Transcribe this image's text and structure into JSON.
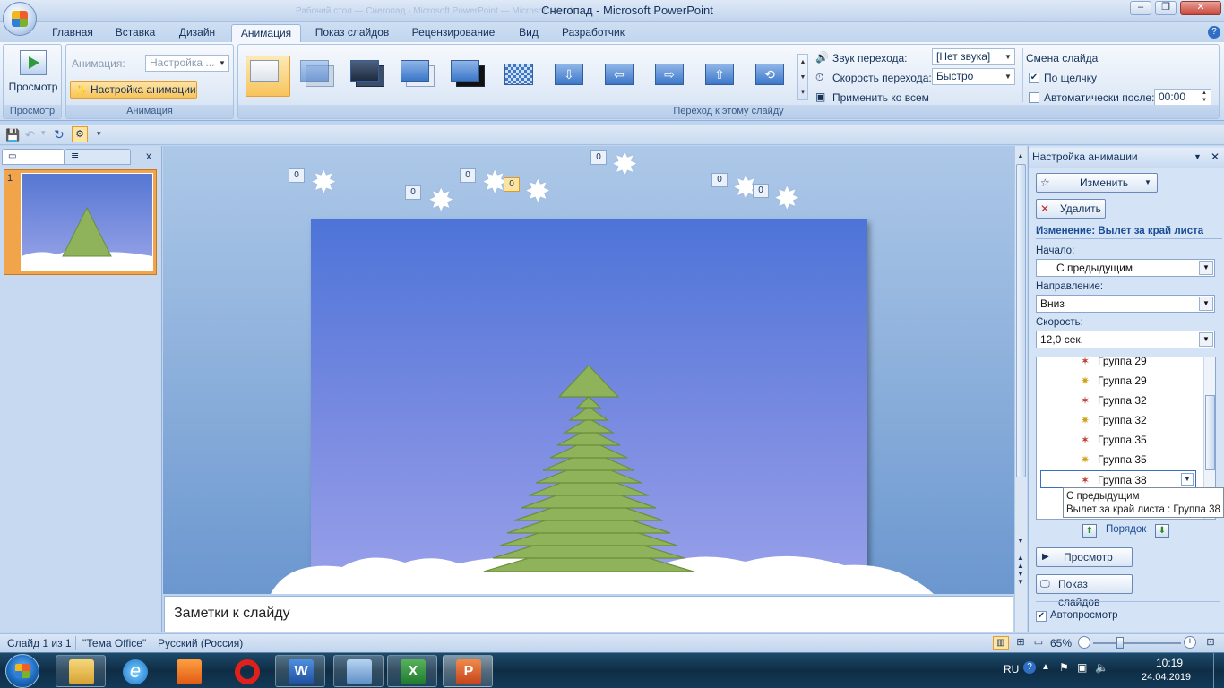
{
  "window": {
    "title": "Снегопад - Microsoft PowerPoint",
    "ghost_title": "Рабочий стол — Снегопад - Microsoft PowerPoint — Microsoft Word"
  },
  "tabs": [
    "Главная",
    "Вставка",
    "Дизайн",
    "Анимация",
    "Показ слайдов",
    "Рецензирование",
    "Вид",
    "Разработчик"
  ],
  "active_tab": "Анимация",
  "ribbon": {
    "preview_label": "Просмотр",
    "preview_group": "Просмотр",
    "animation_label": "Анимация:",
    "animation_value": "Настройка ...",
    "custom_anim_label": "Настройка анимации",
    "animation_group": "Анимация",
    "transition_group": "Переход к этому слайду",
    "sound_label": "Звук перехода:",
    "sound_value": "[Нет звука]",
    "speed_label": "Скорость перехода:",
    "speed_value": "Быстро",
    "apply_all_label": "Применить ко всем",
    "advance_title": "Смена слайда",
    "on_click_label": "По щелчку",
    "on_click_checked": true,
    "auto_after_label": "Автоматически после:",
    "auto_after_checked": false,
    "auto_after_value": "00:00"
  },
  "left_pane": {
    "close": "x",
    "slide_number": "1"
  },
  "main": {
    "tags": [
      "0",
      "0",
      "0",
      "0",
      "0",
      "0",
      "0"
    ],
    "highlight_tag": "0"
  },
  "notes_placeholder": "Заметки к слайду",
  "task_pane": {
    "title": "Настройка анимации",
    "change_btn": "Изменить",
    "delete_btn": "Удалить",
    "effect_title": "Изменение: Вылет за край листа",
    "start_label": "Начало:",
    "start_value": "С предыдущим",
    "direction_label": "Направление:",
    "direction_value": "Вниз",
    "speed_label": "Скорость:",
    "speed_value": "12,0 сек.",
    "items": [
      "Группа 29",
      "Группа 29",
      "Группа 32",
      "Группа 32",
      "Группа 35",
      "Группа 35",
      "Группа 38"
    ],
    "selected_item": "Группа 38",
    "order_label": "Порядок",
    "preview_btn": "Просмотр",
    "slideshow_btn": "Показ слайдов",
    "autopreview_label": "Автопросмотр",
    "autopreview_checked": true,
    "tooltip_line1": "С предыдущим",
    "tooltip_line2": "Вылет за край листа : Группа 38"
  },
  "status": {
    "slide": "Слайд 1 из 1",
    "theme": "\"Тема Office\"",
    "language": "Русский (Россия)",
    "zoom": "65%"
  },
  "taskbar": {
    "lang": "RU",
    "time": "10:19",
    "date": "24.04.2019"
  },
  "colors": {
    "accent": "#f7c45c",
    "ribbon": "#dbe7f6",
    "slide_top": "#4d74d8",
    "tree": "#8fb35a"
  }
}
